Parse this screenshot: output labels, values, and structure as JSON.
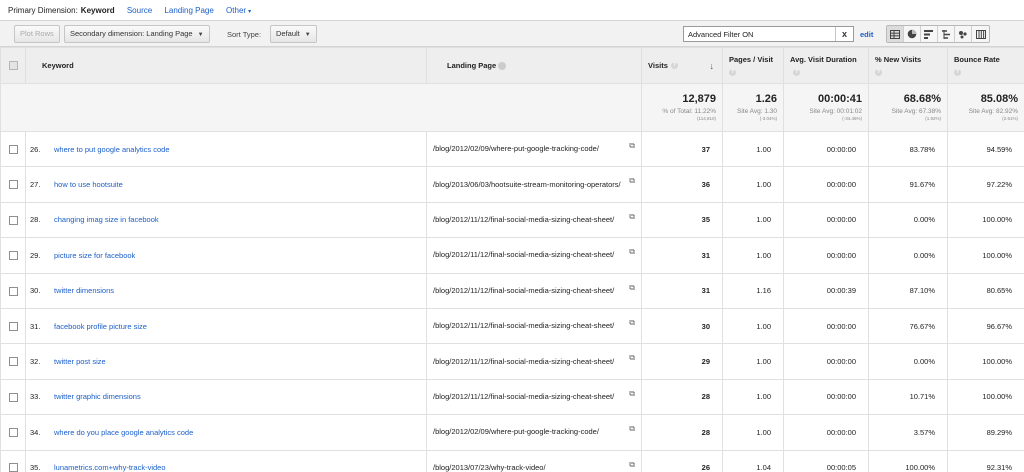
{
  "dimension_bar": {
    "label": "Primary Dimension:",
    "current": "Keyword",
    "links": [
      "Source",
      "Landing Page",
      "Other"
    ]
  },
  "toolbar": {
    "plot_rows": "Plot Rows",
    "secondary_dimension": "Secondary dimension: Landing Page",
    "sort_type_label": "Sort Type:",
    "sort_type_value": "Default",
    "filter_value": "Advanced Filter ON",
    "clear": "x",
    "edit": "edit"
  },
  "columns": {
    "keyword": "Keyword",
    "landing_page": "Landing Page",
    "visits": "Visits",
    "pages_visit": "Pages / Visit",
    "avg_duration": "Avg. Visit Duration",
    "new_visits": "% New Visits",
    "bounce_rate": "Bounce Rate"
  },
  "totals": {
    "visits": {
      "value": "12,879",
      "sub": "% of Total: 11.22%",
      "tiny": "(114,810)"
    },
    "pages_visit": {
      "value": "1.26",
      "sub": "Site Avg: 1.30",
      "tiny": "(-3.04%)"
    },
    "avg_duration": {
      "value": "00:00:41",
      "sub": "Site Avg: 00:01:02",
      "tiny": "(-34.46%)"
    },
    "new_visits": {
      "value": "68.68%",
      "sub": "Site Avg: 67.38%",
      "tiny": "(1.92%)"
    },
    "bounce_rate": {
      "value": "85.08%",
      "sub": "Site Avg: 82.92%",
      "tiny": "(2.61%)"
    }
  },
  "rows": [
    {
      "idx": "26.",
      "keyword": "where to put google analytics code",
      "landing_page": "/blog/2012/02/09/where-put-google-tracking-code/",
      "visits": "37",
      "pages_visit": "1.00",
      "avg_duration": "00:00:00",
      "new_visits": "83.78%",
      "bounce_rate": "94.59%"
    },
    {
      "idx": "27.",
      "keyword": "how to use hootsuite",
      "landing_page": "/blog/2013/06/03/hootsuite-stream-monitoring-operators/",
      "visits": "36",
      "pages_visit": "1.00",
      "avg_duration": "00:00:00",
      "new_visits": "91.67%",
      "bounce_rate": "97.22%"
    },
    {
      "idx": "28.",
      "keyword": "changing imag size in facebook",
      "landing_page": "/blog/2012/11/12/final-social-media-sizing-cheat-sheet/",
      "visits": "35",
      "pages_visit": "1.00",
      "avg_duration": "00:00:00",
      "new_visits": "0.00%",
      "bounce_rate": "100.00%"
    },
    {
      "idx": "29.",
      "keyword": "picture size for facebook",
      "landing_page": "/blog/2012/11/12/final-social-media-sizing-cheat-sheet/",
      "visits": "31",
      "pages_visit": "1.00",
      "avg_duration": "00:00:00",
      "new_visits": "0.00%",
      "bounce_rate": "100.00%"
    },
    {
      "idx": "30.",
      "keyword": "twitter dimensions",
      "landing_page": "/blog/2012/11/12/final-social-media-sizing-cheat-sheet/",
      "visits": "31",
      "pages_visit": "1.16",
      "avg_duration": "00:00:39",
      "new_visits": "87.10%",
      "bounce_rate": "80.65%"
    },
    {
      "idx": "31.",
      "keyword": "facebook profile picture size",
      "landing_page": "/blog/2012/11/12/final-social-media-sizing-cheat-sheet/",
      "visits": "30",
      "pages_visit": "1.00",
      "avg_duration": "00:00:00",
      "new_visits": "76.67%",
      "bounce_rate": "96.67%"
    },
    {
      "idx": "32.",
      "keyword": "twitter post size",
      "landing_page": "/blog/2012/11/12/final-social-media-sizing-cheat-sheet/",
      "visits": "29",
      "pages_visit": "1.00",
      "avg_duration": "00:00:00",
      "new_visits": "0.00%",
      "bounce_rate": "100.00%"
    },
    {
      "idx": "33.",
      "keyword": "twitter graphic dimensions",
      "landing_page": "/blog/2012/11/12/final-social-media-sizing-cheat-sheet/",
      "visits": "28",
      "pages_visit": "1.00",
      "avg_duration": "00:00:00",
      "new_visits": "10.71%",
      "bounce_rate": "100.00%"
    },
    {
      "idx": "34.",
      "keyword": "where do you place google analytics code",
      "landing_page": "/blog/2012/02/09/where-put-google-tracking-code/",
      "visits": "28",
      "pages_visit": "1.00",
      "avg_duration": "00:00:00",
      "new_visits": "3.57%",
      "bounce_rate": "89.29%"
    },
    {
      "idx": "35.",
      "keyword": "lunametrics.com+why-track-video",
      "landing_page": "/blog/2013/07/23/why-track-video/",
      "visits": "26",
      "pages_visit": "1.04",
      "avg_duration": "00:00:05",
      "new_visits": "100.00%",
      "bounce_rate": "92.31%"
    }
  ],
  "icons": {
    "help": "question-icon",
    "sort": "down-arrow-icon",
    "external": "open-page-icon",
    "views": [
      "table-view-icon",
      "pie-view-icon",
      "performance-view-icon",
      "comparison-view-icon",
      "term-cloud-icon",
      "pivot-view-icon"
    ]
  }
}
